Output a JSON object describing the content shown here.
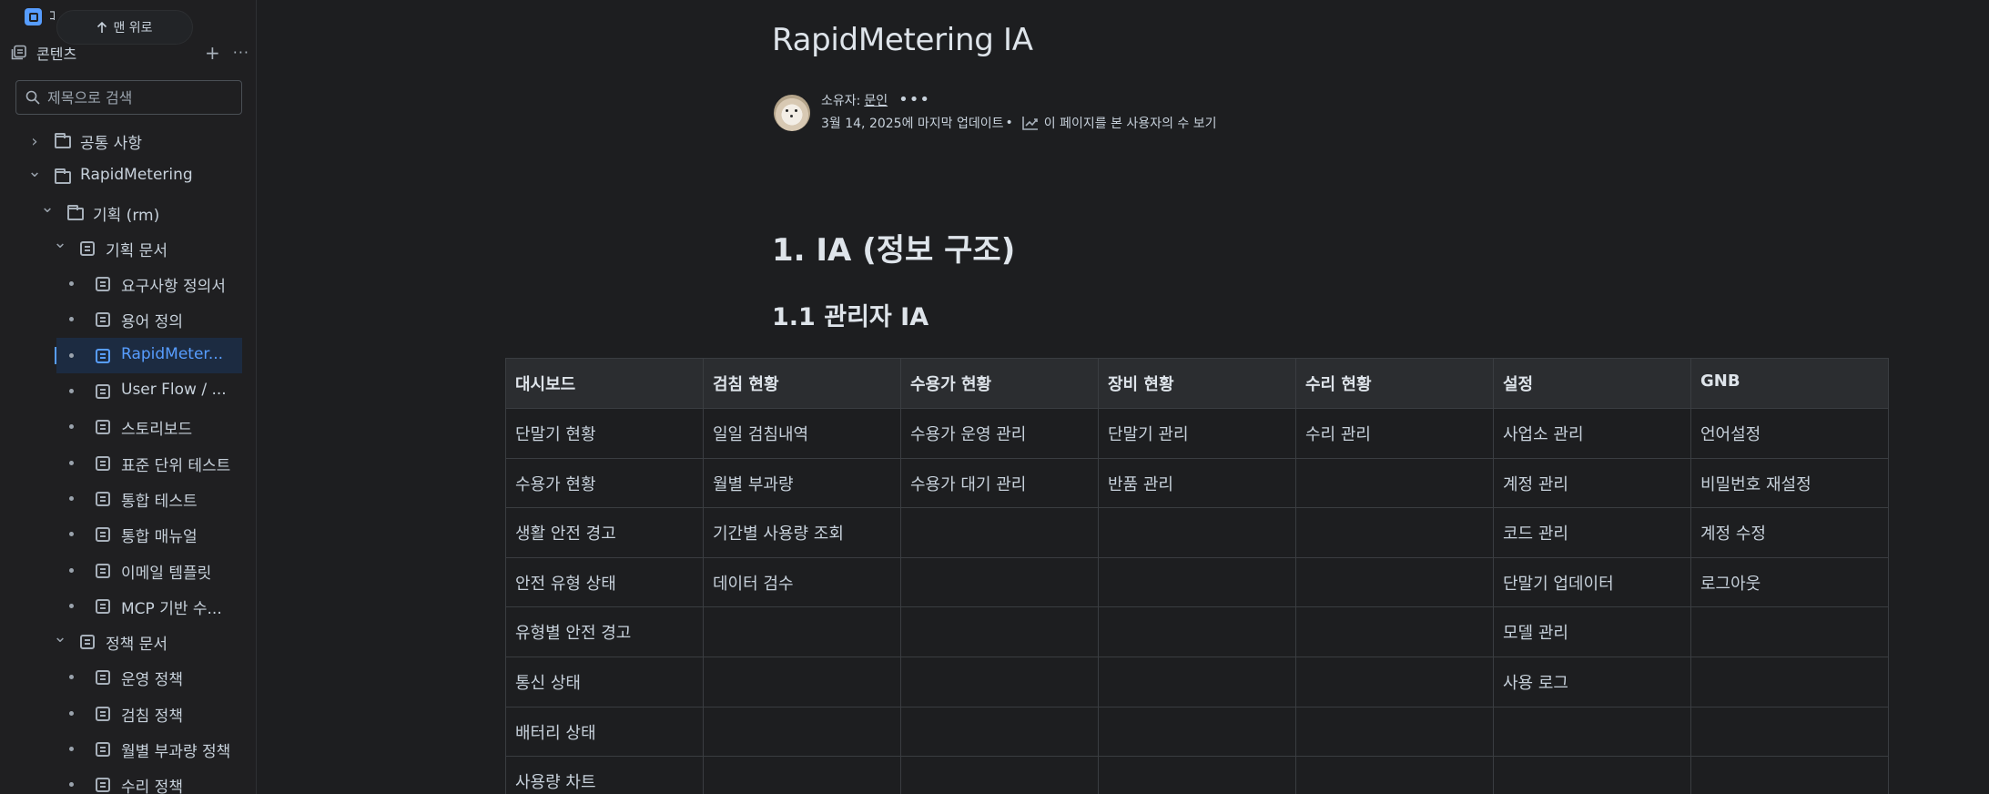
{
  "app": {
    "mark": "ｺ",
    "scroll_top_label": "맨 위로"
  },
  "sidebar": {
    "section_label": "콘텐츠",
    "add_symbol": "+",
    "more_symbol": "···",
    "search_placeholder": "제목으로 검색",
    "items": [
      {
        "label": "공통 사항",
        "type": "folder",
        "expanded": false
      },
      {
        "label": "RapidMetering",
        "type": "folder",
        "expanded": true
      },
      {
        "label": "기획 (rm)",
        "type": "folder",
        "expanded": true
      },
      {
        "label": "기획 문서",
        "type": "page",
        "expanded": true
      },
      {
        "label": "요구사항 정의서",
        "type": "page"
      },
      {
        "label": "용어 정의",
        "type": "page"
      },
      {
        "label": "RapidMeter...",
        "type": "page",
        "active": true
      },
      {
        "label": "User Flow / ...",
        "type": "page"
      },
      {
        "label": "스토리보드",
        "type": "page"
      },
      {
        "label": "표준 단위 테스트",
        "type": "page"
      },
      {
        "label": "통합 테스트",
        "type": "page"
      },
      {
        "label": "통합 매뉴얼",
        "type": "page"
      },
      {
        "label": "이메일 템플릿",
        "type": "page"
      },
      {
        "label": "MCP 기반 수...",
        "type": "page"
      },
      {
        "label": "정책 문서",
        "type": "page",
        "expanded": true
      },
      {
        "label": "운영 정책",
        "type": "page"
      },
      {
        "label": "검침 정책",
        "type": "page"
      },
      {
        "label": "월별 부과량 정책",
        "type": "page"
      },
      {
        "label": "수리 정책",
        "type": "page"
      }
    ]
  },
  "page": {
    "title": "RapidMetering IA",
    "owner_prefix": "소유자:",
    "owner_name": "문인",
    "more": "•••",
    "updated": "3월 14, 2025에 마지막 업데이트",
    "bullet": "•",
    "viewers_link": "이 페이지를 본 사용자의 수 보기",
    "heading1": "1. IA (정보 구조)",
    "heading2": "1.1 관리자 IA"
  },
  "table": {
    "headers": [
      "대시보드",
      "검침 현황",
      "수용가 현황",
      "장비 현황",
      "수리 현황",
      "설정",
      "GNB"
    ],
    "rows": [
      [
        "단말기 현황",
        "일일 검침내역",
        "수용가 운영 관리",
        "단말기 관리",
        "수리 관리",
        "사업소 관리",
        "언어설정"
      ],
      [
        "수용가 현황",
        "월별 부과량",
        "수용가 대기 관리",
        "반품 관리",
        "",
        "계정 관리",
        "비밀번호 재설정"
      ],
      [
        "생활 안전 경고",
        "기간별 사용량 조회",
        "",
        "",
        "",
        "코드 관리",
        "계정 수정"
      ],
      [
        "안전 유형 상태",
        "데이터 검수",
        "",
        "",
        "",
        "단말기 업데이터",
        "로그아웃"
      ],
      [
        "유형별 안전 경고",
        "",
        "",
        "",
        "",
        "모델 관리",
        ""
      ],
      [
        "통신 상태",
        "",
        "",
        "",
        "",
        "사용 로그",
        ""
      ],
      [
        "배터리 상태",
        "",
        "",
        "",
        "",
        "",
        ""
      ],
      [
        "사용량 차트",
        "",
        "",
        "",
        "",
        "",
        ""
      ]
    ]
  }
}
